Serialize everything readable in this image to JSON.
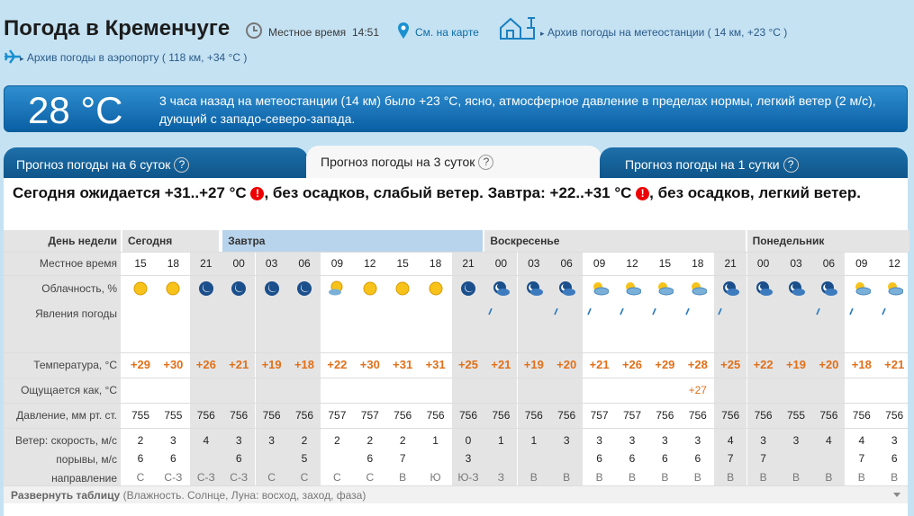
{
  "header": {
    "title": "Погода в Кременчуге",
    "local_time_label": "Местное время",
    "local_time": "14:51",
    "map_link": "См. на карте",
    "archive_station": "Архив погоды на метеостанции ( 14 км, +23 °C )",
    "archive_airport": "Архив погоды в аэропорту ( 118 км, +34 °C )"
  },
  "now": {
    "temp": "28 °C",
    "text": "3 часа назад на метеостанции (14 км) было +23 °C, ясно, атмосферное давление в пределах нормы, легкий ветер (2 м/с), дующий с западо-северо-запада."
  },
  "tabs": [
    {
      "label": "Прогноз погоды на 6 суток",
      "help": "?"
    },
    {
      "label": "Прогноз погоды на 3 суток",
      "help": "?"
    },
    {
      "label": "Прогноз погоды на 1 сутки",
      "help": "?"
    }
  ],
  "summary": {
    "part1": "Сегодня ожидается +31..+27 °C",
    "part2": ", без осадков, слабый ветер. Завтра: +22..+31 °C",
    "part3": ", без осадков, легкий ветер.",
    "warn": "!"
  },
  "labels": {
    "day": "День недели",
    "time": "Местное время",
    "cloud": "Облачность, %",
    "phen": "Явления погоды",
    "temp": "Температура, °C",
    "feels": "Ощущается как, °C",
    "press": "Давление, мм рт. ст.",
    "wind": "Ветер: скорость, м/с",
    "gust": "порывы, м/с",
    "dir": "направление"
  },
  "days": [
    "Сегодня",
    "Завтра",
    "Воскресенье",
    "Понедельник"
  ],
  "forecast": {
    "times": [
      "15",
      "18",
      "21",
      "00",
      "03",
      "06",
      "09",
      "12",
      "15",
      "18",
      "21",
      "00",
      "03",
      "06",
      "09",
      "12",
      "15",
      "18",
      "21",
      "00",
      "03",
      "06",
      "09",
      "12"
    ],
    "temps": [
      "+29",
      "+30",
      "+26",
      "+21",
      "+19",
      "+18",
      "+22",
      "+30",
      "+31",
      "+31",
      "+25",
      "+21",
      "+19",
      "+20",
      "+21",
      "+26",
      "+29",
      "+28",
      "+25",
      "+22",
      "+19",
      "+20",
      "+18",
      "+21"
    ],
    "feels": [
      "",
      "",
      "",
      "",
      "",
      "",
      "",
      "",
      "",
      "",
      "",
      "",
      "",
      "",
      "",
      "",
      "",
      "+27",
      "",
      "",
      "",
      "",
      "",
      ""
    ],
    "pressure": [
      "755",
      "755",
      "756",
      "756",
      "756",
      "756",
      "757",
      "757",
      "756",
      "756",
      "756",
      "756",
      "756",
      "756",
      "757",
      "757",
      "756",
      "756",
      "756",
      "756",
      "755",
      "756",
      "756",
      "756"
    ],
    "wind": [
      "2",
      "3",
      "4",
      "3",
      "3",
      "2",
      "2",
      "2",
      "2",
      "1",
      "0",
      "1",
      "1",
      "3",
      "3",
      "3",
      "3",
      "3",
      "4",
      "3",
      "3",
      "4",
      "4",
      "3"
    ],
    "gusts": [
      "6",
      "6",
      "",
      "6",
      "",
      "5",
      "",
      "6",
      "7",
      "",
      "3",
      "",
      "",
      "",
      "6",
      "6",
      "6",
      "6",
      "7",
      "7",
      "",
      "",
      "7",
      "6"
    ],
    "dirs": [
      "С",
      "С-З",
      "С-З",
      "С-З",
      "С",
      "С",
      "С",
      "С",
      "В",
      "Ю",
      "Ю-З",
      "З",
      "В",
      "В",
      "В",
      "В",
      "В",
      "В",
      "В",
      "В",
      "В",
      "В",
      "В",
      "В"
    ],
    "icons": [
      "sun-icon",
      "sun-icon",
      "moon-clear-icon",
      "moon-clear-icon",
      "moon-clear-icon",
      "moon-clear-icon",
      "sun-partly-icon",
      "sun-icon",
      "sun-icon",
      "sun-icon",
      "moon-clear-icon",
      "moon-cloud-icon",
      "moon-cloud-icon",
      "moon-cloud-icon",
      "sun-cloud-icon",
      "sun-cloud-icon",
      "sun-cloud-icon",
      "sun-cloud-icon",
      "moon-cloud-icon",
      "moon-cloud-icon",
      "moon-cloud-icon",
      "moon-cloud-icon",
      "sun-cloud-icon",
      "sun-cloud-icon"
    ]
  },
  "footer": {
    "expand": "Развернуть таблицу",
    "extra": "(Влажность. Солнце, Луна: восход, заход, фаза)"
  },
  "colors": {
    "temp_text": "#e0701a",
    "night_col": "#e4e4e4",
    "tab_blue": "#0d5489"
  }
}
